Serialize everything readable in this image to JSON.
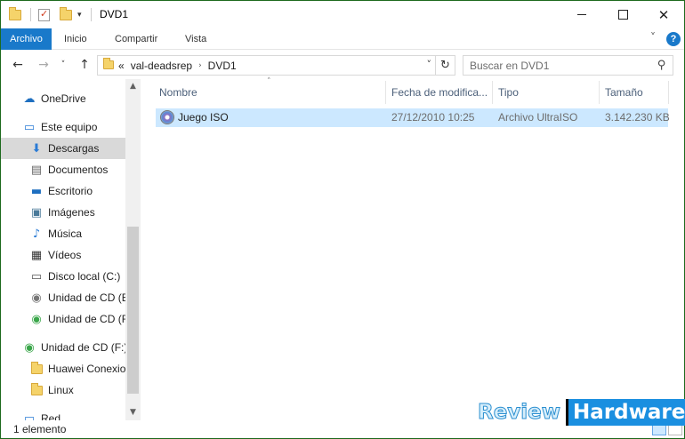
{
  "window": {
    "title": "DVD1",
    "accent": "#1979ca"
  },
  "ribbon": {
    "tabs": [
      "Archivo",
      "Inicio",
      "Compartir",
      "Vista"
    ],
    "help": "?"
  },
  "address": {
    "overflow": "«",
    "crumbs": [
      "val-deadsrep",
      "DVD1"
    ]
  },
  "search": {
    "placeholder": "Buscar en DVD1"
  },
  "navpane": {
    "items": [
      {
        "label": "OneDrive",
        "icon": "onedrive-icon"
      },
      {
        "label": "Este equipo",
        "icon": "computer-icon"
      },
      {
        "label": "Descargas",
        "icon": "downloads-icon",
        "selected": true
      },
      {
        "label": "Documentos",
        "icon": "documents-icon"
      },
      {
        "label": "Escritorio",
        "icon": "desktop-icon"
      },
      {
        "label": "Imágenes",
        "icon": "pictures-icon"
      },
      {
        "label": "Música",
        "icon": "music-icon"
      },
      {
        "label": "Vídeos",
        "icon": "videos-icon"
      },
      {
        "label": "Disco local (C:)",
        "icon": "hard-drive-icon"
      },
      {
        "label": "Unidad de CD (E",
        "icon": "cd-drive-icon"
      },
      {
        "label": "Unidad de CD (F",
        "icon": "cd-drive-green-icon"
      },
      {
        "label": "Unidad de CD (F:)",
        "icon": "cd-drive-green-icon"
      },
      {
        "label": "Huawei Conexio",
        "icon": "folder-icon"
      },
      {
        "label": "Linux",
        "icon": "folder-icon"
      },
      {
        "label": "Red",
        "icon": "network-icon"
      }
    ]
  },
  "columns": {
    "name": "Nombre",
    "date": "Fecha de modifica...",
    "type": "Tipo",
    "size": "Tamaño"
  },
  "files": [
    {
      "name": "Juego ISO",
      "date": "27/12/2010 10:25",
      "type": "Archivo UltraISO",
      "size": "3.142.230 KB"
    }
  ],
  "status": {
    "count": "1 elemento"
  },
  "watermark": {
    "part1": "Review",
    "part2": "Hardware"
  }
}
